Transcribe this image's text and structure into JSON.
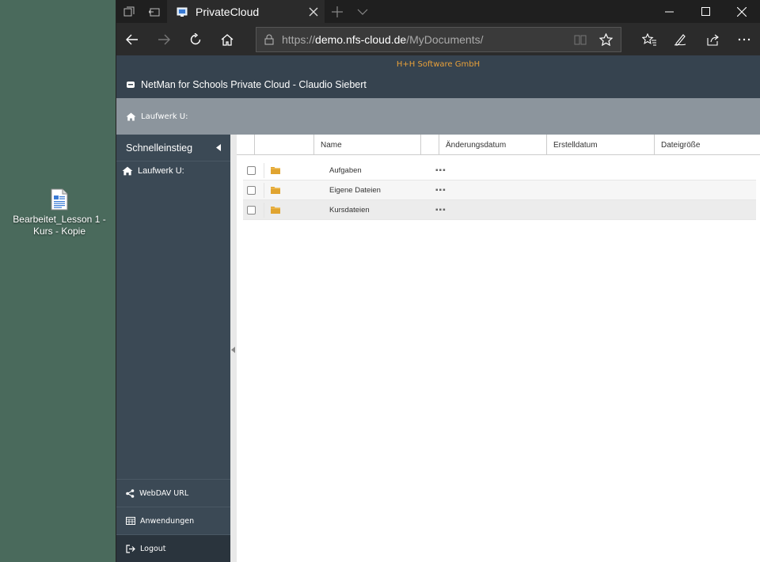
{
  "desktop": {
    "icon_label_line1": "Bearbeitet_Lesson 1 -",
    "icon_label_line2": "Kurs - Kopie"
  },
  "browser": {
    "tab_title": "PrivateCloud",
    "url_scheme": "https://",
    "url_domain": "demo.nfs-cloud.de",
    "url_path": "/MyDocuments/"
  },
  "app": {
    "company": "H+H Software GmbH",
    "title": "NetMan for Schools Private Cloud - Claudio Siebert",
    "breadcrumb": "Laufwerk U:",
    "accent_color": "#e8a03a"
  },
  "sidebar": {
    "header": "Schnelleinstieg",
    "items": [
      {
        "label": "Laufwerk U:"
      }
    ],
    "bottom": [
      {
        "label": "WebDAV URL"
      },
      {
        "label": "Anwendungen"
      },
      {
        "label": "Logout"
      }
    ]
  },
  "table": {
    "columns": [
      "Name",
      "Änderungsdatum",
      "Erstelldatum",
      "Dateigröße"
    ],
    "rows": [
      {
        "name": "Aufgaben",
        "menu": "▪▪▪"
      },
      {
        "name": "Eigene Dateien",
        "menu": "▪▪▪"
      },
      {
        "name": "Kursdateien",
        "menu": "▪▪▪"
      }
    ]
  }
}
